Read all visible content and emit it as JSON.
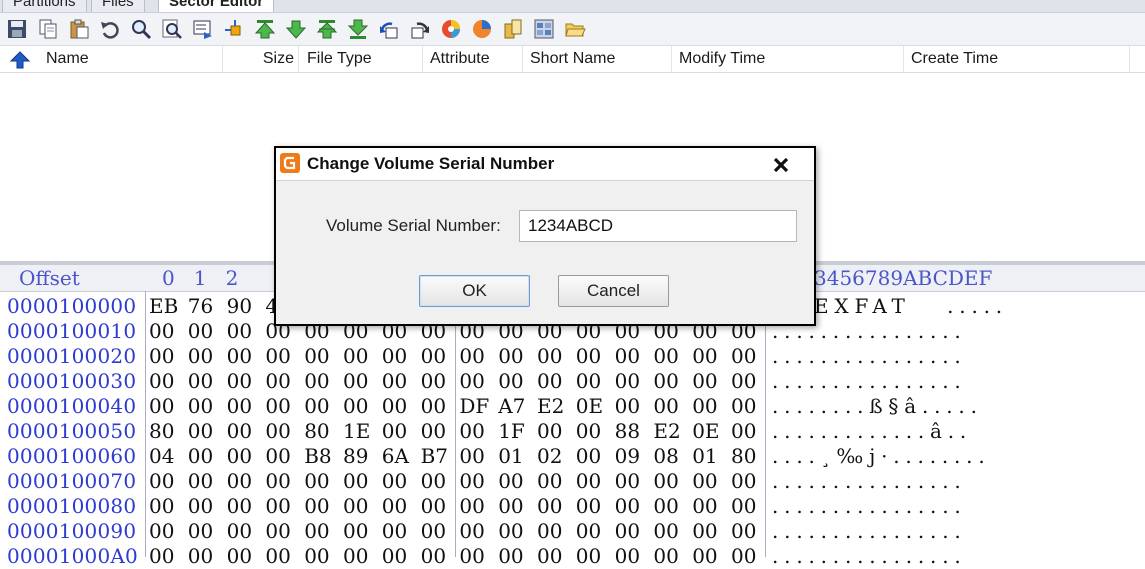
{
  "tabs": [
    "Partitions",
    "Files",
    "Sector Editor"
  ],
  "toolbar": {
    "icons": [
      "save-icon",
      "copy-icon",
      "paste-icon",
      "undo-icon",
      "find-icon",
      "find-next-icon",
      "goto-icon",
      "jump-icon",
      "first-sector-icon",
      "next-sector-icon",
      "prev-block-icon",
      "last-sector-icon",
      "back-icon",
      "forward-icon",
      "colors-icon",
      "pie-icon",
      "clipboard-icon",
      "grid-icon",
      "open-folder-icon"
    ]
  },
  "file_columns": {
    "name": "Name",
    "size": "Size",
    "file_type": "File Type",
    "attribute": "Attribute",
    "short_name": "Short Name",
    "modify_time": "Modify Time",
    "create_time": "Create Time"
  },
  "hex": {
    "offset_header": "Offset",
    "col_header_left": "0   1   2",
    "col_header_right": "3456789ABCDEF",
    "rows": [
      {
        "offset": "0000100000",
        "bytes": [
          "EB",
          "76",
          "90",
          "4",
          "",
          "",
          "",
          "",
          "",
          "",
          "",
          "",
          "",
          "",
          "",
          ""
        ],
        "ascii": "EXFAT   ....."
      },
      {
        "offset": "0000100010",
        "bytes": [
          "00",
          "00",
          "00",
          "00",
          "00",
          "00",
          "00",
          "00",
          "00",
          "00",
          "00",
          "00",
          "00",
          "00",
          "00",
          "00"
        ],
        "ascii": "................"
      },
      {
        "offset": "0000100020",
        "bytes": [
          "00",
          "00",
          "00",
          "00",
          "00",
          "00",
          "00",
          "00",
          "00",
          "00",
          "00",
          "00",
          "00",
          "00",
          "00",
          "00"
        ],
        "ascii": "................"
      },
      {
        "offset": "0000100030",
        "bytes": [
          "00",
          "00",
          "00",
          "00",
          "00",
          "00",
          "00",
          "00",
          "00",
          "00",
          "00",
          "00",
          "00",
          "00",
          "00",
          "00"
        ],
        "ascii": "................"
      },
      {
        "offset": "0000100040",
        "bytes": [
          "00",
          "00",
          "00",
          "00",
          "00",
          "00",
          "00",
          "00",
          "DF",
          "A7",
          "E2",
          "0E",
          "00",
          "00",
          "00",
          "00"
        ],
        "ascii": "........ß§â....."
      },
      {
        "offset": "0000100050",
        "bytes": [
          "80",
          "00",
          "00",
          "00",
          "80",
          "1E",
          "00",
          "00",
          "00",
          "1F",
          "00",
          "00",
          "88",
          "E2",
          "0E",
          "00"
        ],
        "ascii": ".............â.."
      },
      {
        "offset": "0000100060",
        "bytes": [
          "04",
          "00",
          "00",
          "00",
          "B8",
          "89",
          "6A",
          "B7",
          "00",
          "01",
          "02",
          "00",
          "09",
          "08",
          "01",
          "80"
        ],
        "ascii": "....¸‰j·........"
      },
      {
        "offset": "0000100070",
        "bytes": [
          "00",
          "00",
          "00",
          "00",
          "00",
          "00",
          "00",
          "00",
          "00",
          "00",
          "00",
          "00",
          "00",
          "00",
          "00",
          "00"
        ],
        "ascii": "................"
      },
      {
        "offset": "0000100080",
        "bytes": [
          "00",
          "00",
          "00",
          "00",
          "00",
          "00",
          "00",
          "00",
          "00",
          "00",
          "00",
          "00",
          "00",
          "00",
          "00",
          "00"
        ],
        "ascii": "................"
      },
      {
        "offset": "0000100090",
        "bytes": [
          "00",
          "00",
          "00",
          "00",
          "00",
          "00",
          "00",
          "00",
          "00",
          "00",
          "00",
          "00",
          "00",
          "00",
          "00",
          "00"
        ],
        "ascii": "................"
      },
      {
        "offset": "00001000A0",
        "bytes": [
          "00",
          "00",
          "00",
          "00",
          "00",
          "00",
          "00",
          "00",
          "00",
          "00",
          "00",
          "00",
          "00",
          "00",
          "00",
          "00"
        ],
        "ascii": "................"
      }
    ]
  },
  "dialog": {
    "title": "Change Volume Serial Number",
    "label": "Volume Serial Number:",
    "value": "1234ABCD",
    "ok_label": "OK",
    "cancel_label": "Cancel"
  }
}
